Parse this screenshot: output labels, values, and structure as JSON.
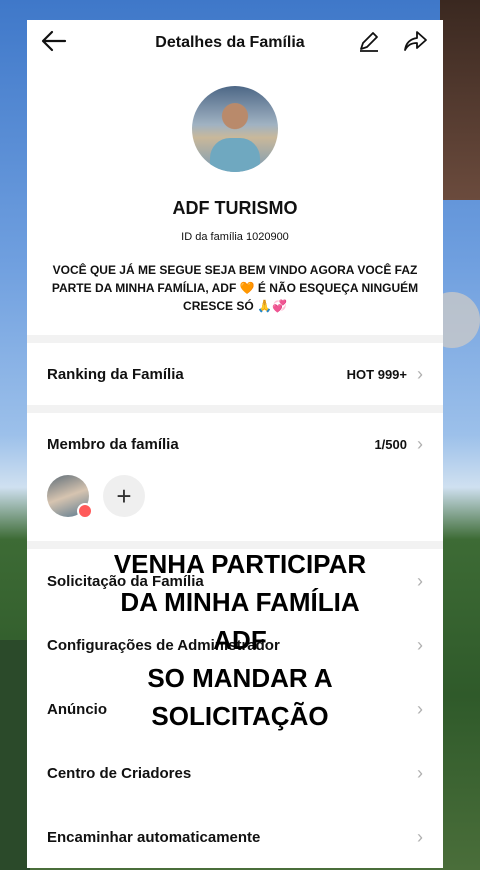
{
  "header": {
    "title": "Detalhes da Família",
    "back_icon": "arrow-left-icon",
    "edit_icon": "pencil-icon",
    "share_icon": "share-arrow-icon"
  },
  "profile": {
    "name": "ADF TURISMO",
    "family_id": "ID da família 1020900",
    "bio": "VOCÊ QUE JÁ ME SEGUE SEJA BEM VINDO AGORA VOCÊ FAZ PARTE DA MINHA FAMÍLIA, ADF 🧡 É NÃO ESQUEÇA NINGUÉM CRESCE SÓ 🙏💞"
  },
  "ranking": {
    "label": "Ranking da Família",
    "value": "HOT 999+"
  },
  "members": {
    "label": "Membro da família",
    "count": "1/500",
    "add_symbol": "+"
  },
  "menu": {
    "request": "Solicitação da Família",
    "admin": "Configurações de Administrador",
    "notice": "Anúncio",
    "creators": "Centro de Criadores",
    "forward": "Encaminhar automaticamente"
  },
  "overlay_text": {
    "line1": "VENHA PARTICIPAR",
    "line2": "DA MINHA FAMÍLIA",
    "line3": "ADF",
    "line4": "SO MANDAR A",
    "line5": "SOLICITAÇÃO"
  },
  "chevron": "›",
  "colors": {
    "panel_bg": "#f2f2f2",
    "card_bg": "#ffffff",
    "badge": "#ff5a5a"
  }
}
